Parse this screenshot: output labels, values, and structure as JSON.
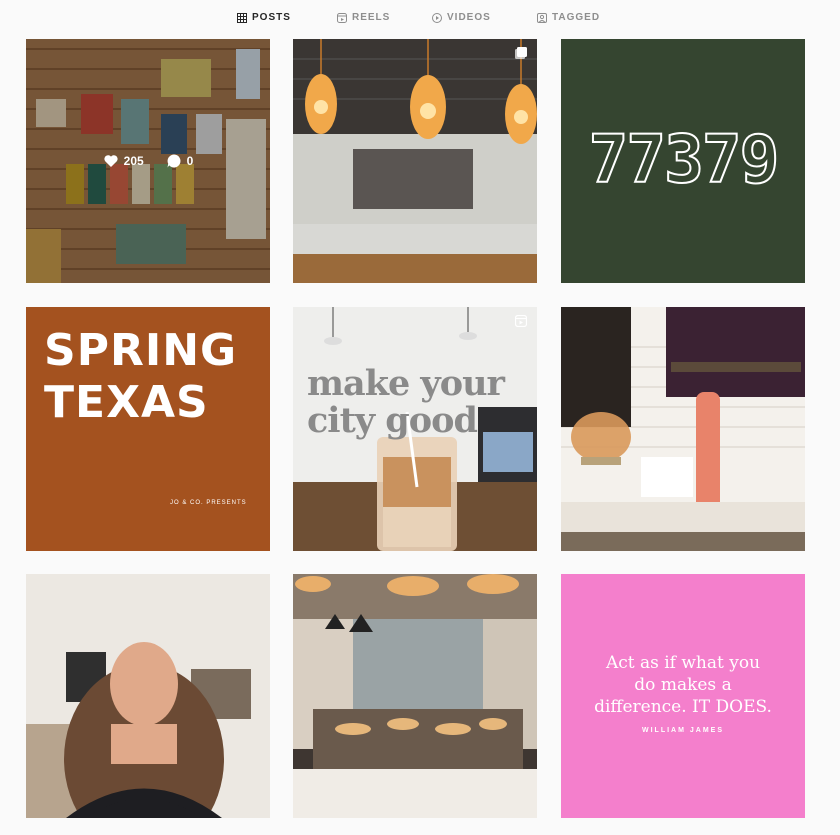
{
  "tabs": [
    {
      "label": "POSTS",
      "icon": "grid-icon",
      "active": true
    },
    {
      "label": "REELS",
      "icon": "reels-icon",
      "active": false
    },
    {
      "label": "VIDEOS",
      "icon": "video-icon",
      "active": false
    },
    {
      "label": "TAGGED",
      "icon": "tagged-icon",
      "active": false
    }
  ],
  "posts": [
    {
      "subject": "shop-shelves",
      "likes": "205",
      "comments": "0",
      "hovered": true
    },
    {
      "subject": "coffee-bar-pendant-lights",
      "badge": "multiple-posts-icon"
    },
    {
      "text": "77379",
      "bg": "#354530"
    },
    {
      "title": "SPRING\nTEXAS",
      "subtitle": "JO & CO. PRESENTS",
      "bg": "#a4521f"
    },
    {
      "wall_text": "make your\ncity good",
      "badge": "reel-icon"
    },
    {
      "subject": "bakery-counter-wine"
    },
    {
      "subject": "woman-portrait"
    },
    {
      "subject": "bakery-case"
    },
    {
      "quote": "Act as if what you\ndo makes a\ndifference. IT DOES.",
      "author": "WILLIAM JAMES",
      "bg": "#f47fcc"
    }
  ]
}
